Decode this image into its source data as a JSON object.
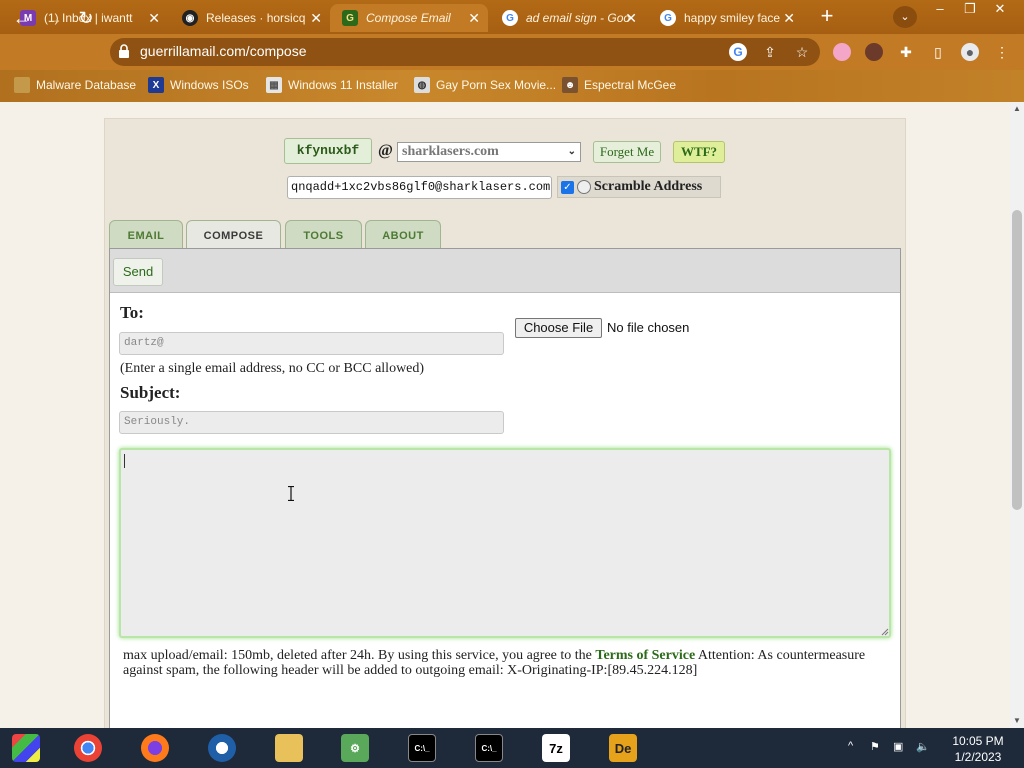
{
  "browser": {
    "tabs": [
      {
        "title": "(1) Inbox | iwantt",
        "icon": "gmail-icon"
      },
      {
        "title": "Releases · horsicq",
        "icon": "github-icon"
      },
      {
        "title": "Compose Email",
        "icon": "guerrillamail-icon"
      },
      {
        "title": "ad email sign - Goo",
        "icon": "google-icon"
      },
      {
        "title": "happy smiley face",
        "icon": "google-icon"
      }
    ],
    "new_tab": "+",
    "url": "guerrillamail.com/compose",
    "bookmarks": [
      {
        "label": "Malware Database"
      },
      {
        "label": "Windows ISOs"
      },
      {
        "label": "Windows 11 Installer"
      },
      {
        "label": "Gay Porn Sex Movie..."
      },
      {
        "label": "Espectral McGee"
      }
    ]
  },
  "page": {
    "username": "kfynuxbf",
    "at": "@",
    "domain": "sharklasers.com",
    "forget_me": "Forget Me",
    "wtf": "WTF?",
    "full_address": "qnqadd+1xc2vbs86glf0@sharklasers.com",
    "scramble_label": "Scramble Address",
    "scramble_checked": true,
    "tabs": [
      "EMAIL",
      "COMPOSE",
      "TOOLS",
      "ABOUT"
    ],
    "active_tab": "COMPOSE",
    "send_label": "Send",
    "to_label": "To:",
    "to_placeholder": "dartz@",
    "to_hint": "(Enter a single email address, no CC or BCC allowed)",
    "subject_label": "Subject:",
    "subject_placeholder": "Seriously.",
    "choose_file": "Choose File",
    "no_file": "No file chosen",
    "footer_text": "max upload/email: 150mb, deleted after 24h. By using this service, you agree to the",
    "tos_link": "Terms of Service",
    "footer_text2": "Attention: As countermeasure against spam, the following header will be added to outgoing email: X-Originating-IP:[89.45.224.128]"
  },
  "taskbar": {
    "apps": [
      "start",
      "chrome",
      "firefox",
      "obama",
      "file-explorer",
      "network",
      "cmd",
      "cmd",
      "7zip",
      "detect-it-easy"
    ],
    "labels": {
      "7zip": "7z",
      "die": "De"
    },
    "time": "10:05 PM",
    "date": "1/2/2023"
  },
  "colors": {
    "accent_green": "#2c6a1a",
    "chrome_brown": "#c27a24"
  }
}
